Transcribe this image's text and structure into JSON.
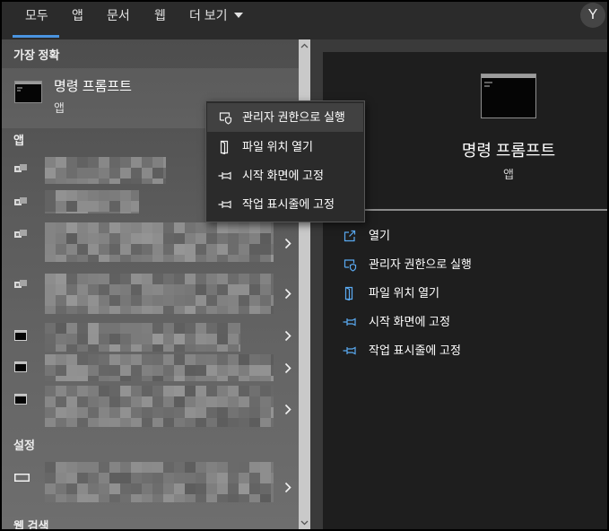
{
  "tabs": {
    "all": "모두",
    "apps": "앱",
    "documents": "문서",
    "web": "웹",
    "more": "더 보기"
  },
  "user": {
    "avatar_letter": "Y"
  },
  "results": {
    "best_match_header": "가장 정확",
    "best_match": {
      "title": "명령 프롬프트",
      "subtitle": "앱",
      "icon": "command-prompt-icon"
    },
    "apps_header": "앱",
    "settings_header": "설정",
    "web_search_header": "웹 검색"
  },
  "context_menu": {
    "items": [
      {
        "label": "관리자 권한으로 실행",
        "icon": "shield-icon"
      },
      {
        "label": "파일 위치 열기",
        "icon": "file-location-icon"
      },
      {
        "label": "시작 화면에 고정",
        "icon": "pin-icon"
      },
      {
        "label": "작업 표시줄에 고정",
        "icon": "pin-icon"
      }
    ]
  },
  "preview": {
    "title": "명령 프롬프트",
    "subtitle": "앱",
    "icon": "command-prompt-icon",
    "actions": [
      {
        "label": "열기",
        "icon": "open-icon"
      },
      {
        "label": "관리자 권한으로 실행",
        "icon": "shield-icon"
      },
      {
        "label": "파일 위치 열기",
        "icon": "file-location-icon"
      },
      {
        "label": "시작 화면에 고정",
        "icon": "pin-icon"
      },
      {
        "label": "작업 표시줄에 고정",
        "icon": "pin-icon"
      }
    ]
  },
  "colors": {
    "accent": "#4a94e0",
    "action_icon": "#5aaaf2",
    "tab_bar": "#2b2b2b",
    "preview_pane": "#1e1e1e",
    "menu_bg": "#2b2b2b",
    "menu_highlight": "#414141"
  }
}
